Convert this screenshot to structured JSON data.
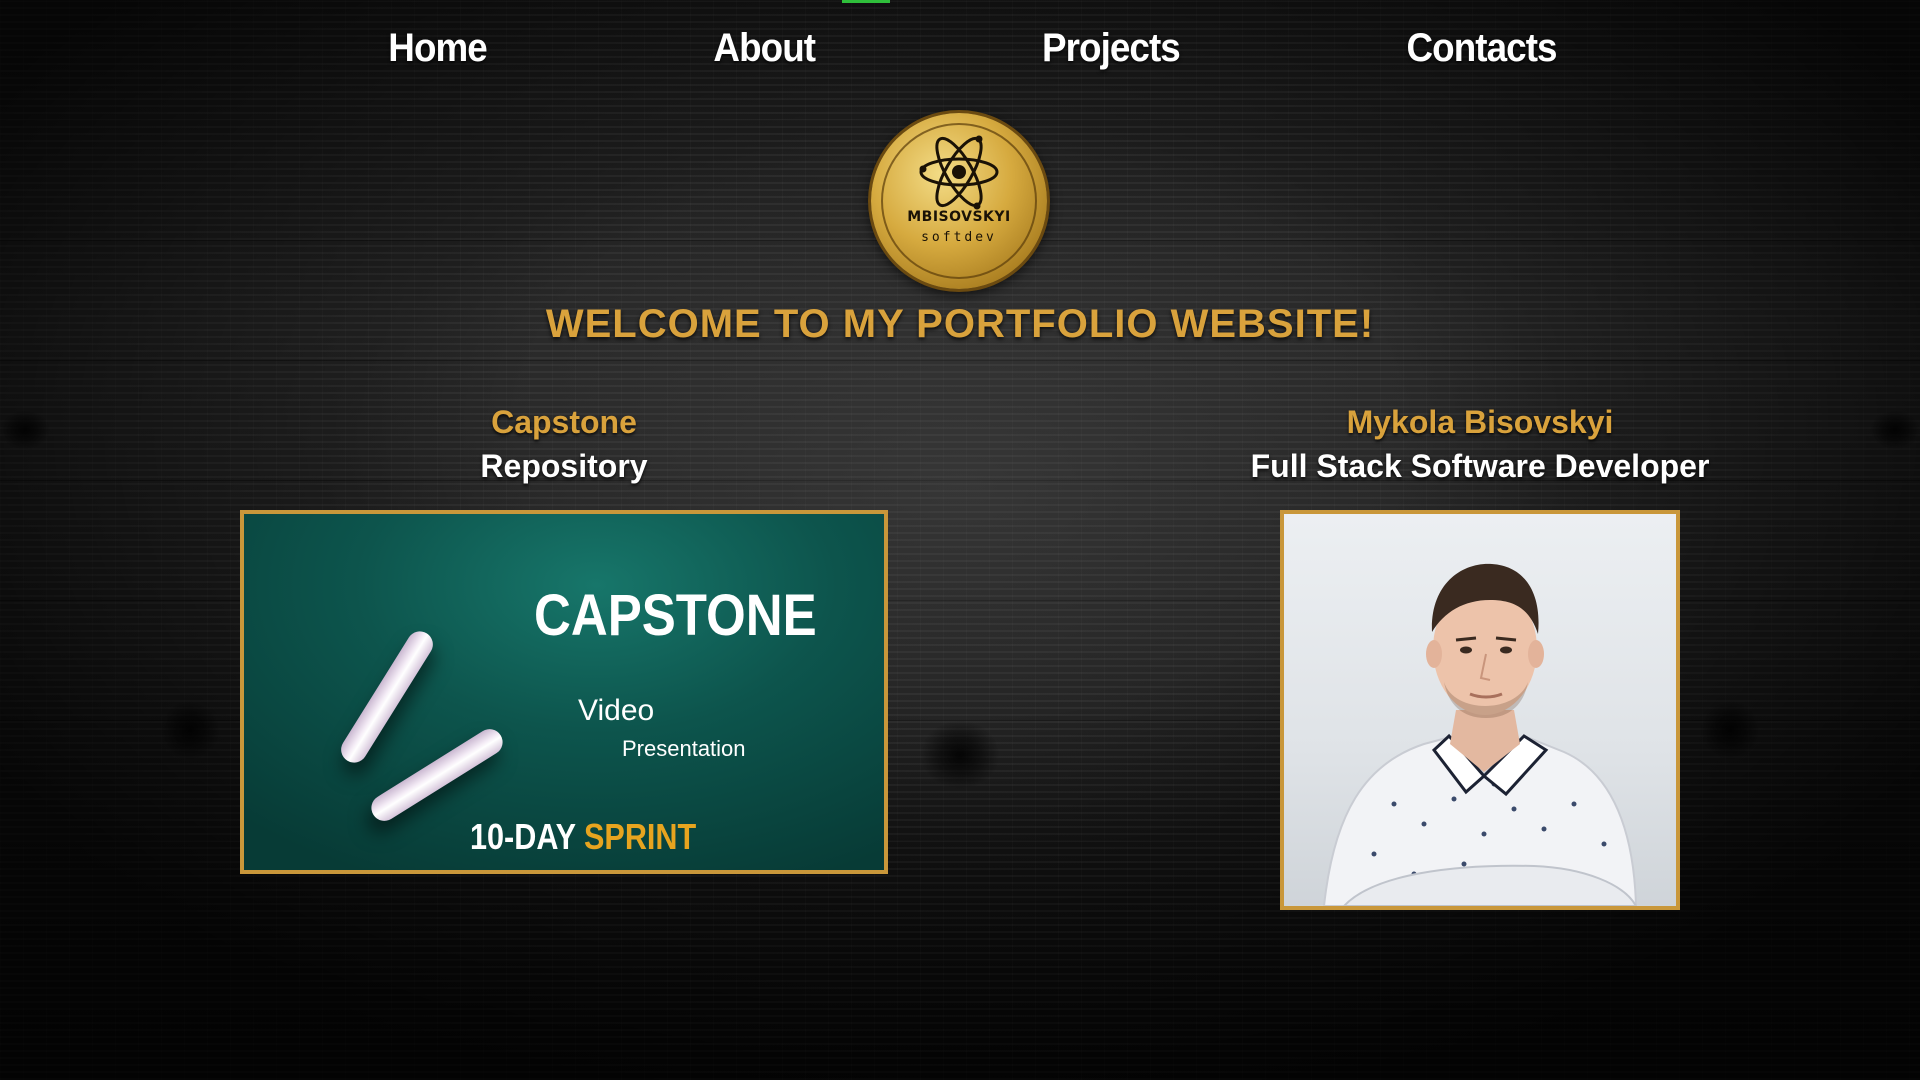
{
  "nav": {
    "items": [
      {
        "label": "Home"
      },
      {
        "label": "About"
      },
      {
        "label": "Projects"
      },
      {
        "label": "Contacts"
      }
    ]
  },
  "logo": {
    "name": "MBISOVSKYI",
    "subtitle": "softdev",
    "icon": "atom-icon"
  },
  "welcome": "WELCOME TO MY PORTFOLIO WEBSITE!",
  "capstone": {
    "title": "Capstone",
    "subtitle": "Repository",
    "card": {
      "heading": "CAPSTONE",
      "line1": "Video",
      "line2": "Presentation",
      "sprint_prefix": "10-DAY",
      "sprint_accent": "SPRINT"
    }
  },
  "profile": {
    "name": "Mykola Bisovskyi",
    "role": "Full Stack Software Developer"
  },
  "colors": {
    "accent_gold": "#d9a23c",
    "frame_gold": "#c9973a",
    "card_teal": "#0d554d",
    "sprint_orange": "#e7a41f",
    "nav_indicator": "#2fbf3b"
  }
}
